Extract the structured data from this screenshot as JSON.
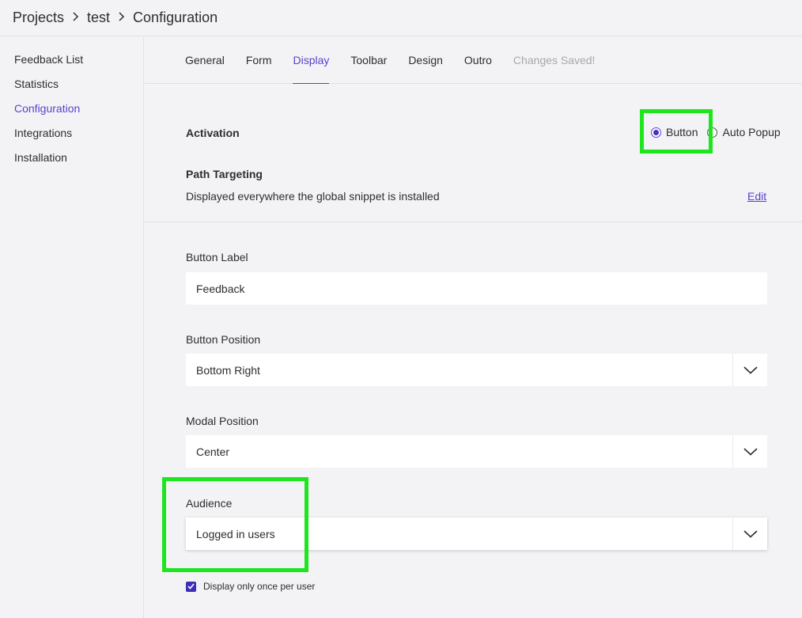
{
  "breadcrumb": {
    "items": [
      "Projects",
      "test",
      "Configuration"
    ]
  },
  "sidebar": {
    "items": [
      {
        "label": "Feedback List"
      },
      {
        "label": "Statistics"
      },
      {
        "label": "Configuration"
      },
      {
        "label": "Integrations"
      },
      {
        "label": "Installation"
      }
    ],
    "active_index": 2
  },
  "tabs": {
    "items": [
      {
        "label": "General"
      },
      {
        "label": "Form"
      },
      {
        "label": "Display"
      },
      {
        "label": "Toolbar"
      },
      {
        "label": "Design"
      },
      {
        "label": "Outro"
      }
    ],
    "active_index": 2,
    "status": "Changes Saved!"
  },
  "activation": {
    "label": "Activation",
    "options": [
      "Button",
      "Auto Popup"
    ],
    "selected": "Button"
  },
  "path_targeting": {
    "label": "Path Targeting",
    "description": "Displayed everywhere the global snippet is installed",
    "edit_label": "Edit"
  },
  "button_label": {
    "label": "Button Label",
    "value": "Feedback"
  },
  "button_position": {
    "label": "Button Position",
    "value": "Bottom Right"
  },
  "modal_position": {
    "label": "Modal Position",
    "value": "Center"
  },
  "audience": {
    "label": "Audience",
    "value": "Logged in users"
  },
  "display_once": {
    "label": "Display only once per user",
    "checked": true
  },
  "colors": {
    "accent": "#5b3fd0",
    "highlight": "#1ee61e",
    "checkbox": "#3d2fb5",
    "background": "#f3f3f5"
  },
  "icons": {
    "breadcrumb_separator": "chevron-right-icon",
    "select": "chevron-down-icon",
    "checkbox": "checkmark-icon"
  }
}
